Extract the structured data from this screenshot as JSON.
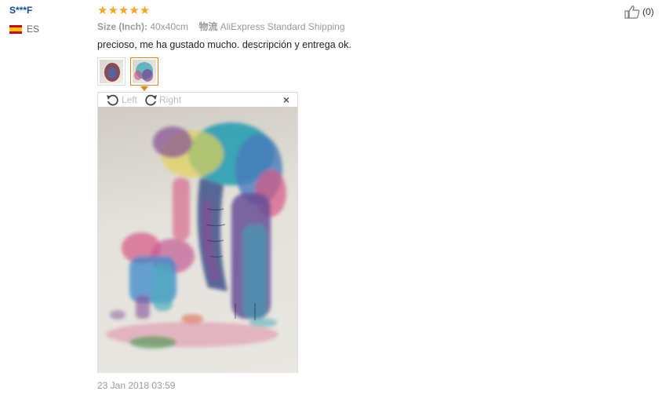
{
  "reviewer": {
    "name": "S***F",
    "country_code": "ES"
  },
  "review": {
    "rating": 5,
    "stars": [
      "★",
      "★",
      "★",
      "★",
      "★"
    ],
    "size_label": "Size (Inch):",
    "size_value": "40x40cm",
    "shipping_label": "物流",
    "shipping_value": "AliExpress Standard Shipping",
    "text": "precioso, me ha gustado mucho. descripción y entrega ok.",
    "date": "23 Jan 2018 03:59"
  },
  "viewer": {
    "rotate_left": "Left",
    "rotate_right": "Right",
    "close": "×"
  },
  "helpful": {
    "count": "(0)"
  },
  "colors": {
    "accent_orange": "#e0851e",
    "star": "#f5a623",
    "name_blue": "#0b4fa8"
  }
}
